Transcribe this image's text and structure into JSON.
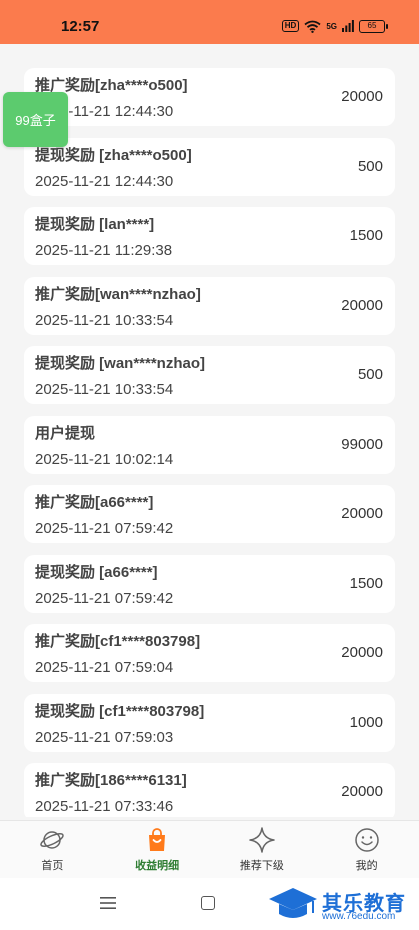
{
  "status_bar": {
    "time": "12:57",
    "hd_label": "HD",
    "network_label": "5G",
    "battery": "65"
  },
  "float_badge": {
    "label": "99盒子"
  },
  "records": [
    {
      "title": "推广奖励[zha****o500]",
      "time": "2025-11-21 12:44:30",
      "amount": "20000"
    },
    {
      "title": "提现奖励 [zha****o500]",
      "time": "2025-11-21 12:44:30",
      "amount": "500"
    },
    {
      "title": "提现奖励 [lan****]",
      "time": "2025-11-21 11:29:38",
      "amount": "1500"
    },
    {
      "title": "推广奖励[wan****nzhao]",
      "time": "2025-11-21 10:33:54",
      "amount": "20000"
    },
    {
      "title": "提现奖励 [wan****nzhao]",
      "time": "2025-11-21 10:33:54",
      "amount": "500"
    },
    {
      "title": "用户提现",
      "time": "2025-11-21 10:02:14",
      "amount": "99000"
    },
    {
      "title": "推广奖励[a66****]",
      "time": "2025-11-21 07:59:42",
      "amount": "20000"
    },
    {
      "title": "提现奖励 [a66****]",
      "time": "2025-11-21 07:59:42",
      "amount": "1500"
    },
    {
      "title": "推广奖励[cf1****803798]",
      "time": "2025-11-21 07:59:04",
      "amount": "20000"
    },
    {
      "title": "提现奖励 [cf1****803798]",
      "time": "2025-11-21 07:59:03",
      "amount": "1000"
    },
    {
      "title": "推广奖励[186****6131]",
      "time": "2025-11-21 07:33:46",
      "amount": "20000"
    }
  ],
  "tabs": [
    {
      "label": "首页",
      "icon": "planet-icon"
    },
    {
      "label": "收益明细",
      "icon": "shopping-bag-icon",
      "active": true
    },
    {
      "label": "推荐下级",
      "icon": "sparkle-icon"
    },
    {
      "label": "我的",
      "icon": "smiley-icon"
    }
  ],
  "colors": {
    "status_bar": "#fb7b4d",
    "badge": "#5ccb6e",
    "active_tab_icon": "#ff7a1a",
    "active_tab_label": "#2e7d32",
    "watermark": "#1e6fd6"
  },
  "watermark": {
    "title": "其乐教育",
    "url": "www.76edu.com"
  }
}
